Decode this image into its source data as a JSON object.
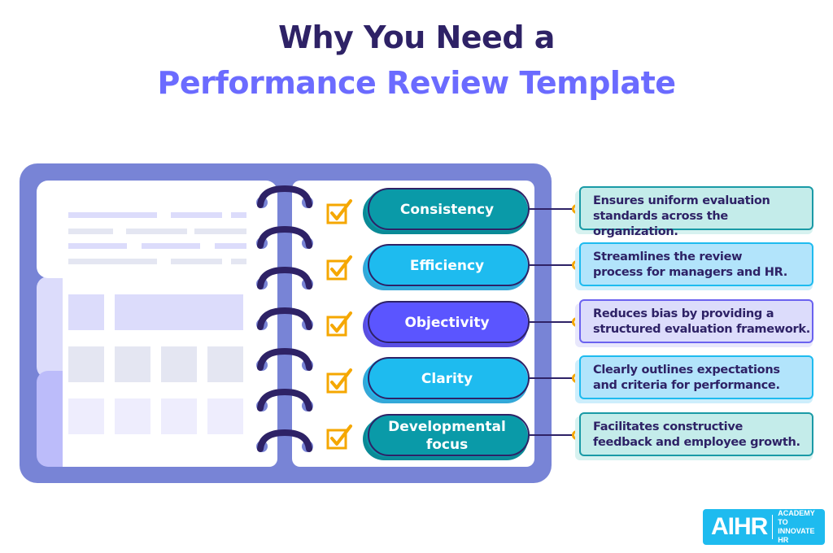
{
  "title": {
    "line1": "Why You Need a",
    "line2": "Performance Review Template"
  },
  "colors": {
    "title_dark": "#2e2266",
    "title_accent": "#6b6bff",
    "notebook": "#7884d6",
    "ring": "#2e2266",
    "check": "#f5a700"
  },
  "benefits": [
    {
      "label": "Consistency",
      "description_line1": "Ensures uniform evaluation",
      "description_line2": "standards across the organization.",
      "pill_color": "#0a9aa8",
      "pill_shadow": "#0a8a96",
      "box_bg": "#c4ecea",
      "box_border": "#1a9aa6",
      "box_shadow": "#d7f2f0"
    },
    {
      "label": "Efficiency",
      "description_line1": "Streamlines the review",
      "description_line2": "process for managers and HR.",
      "pill_color": "#1ebbef",
      "pill_shadow": "#34a8d8",
      "box_bg": "#b2e4fb",
      "box_border": "#1ebbef",
      "box_shadow": "#cdeefc"
    },
    {
      "label": "Objectivity",
      "description_line1": "Reduces bias by providing a",
      "description_line2": "structured evaluation framework.",
      "pill_color": "#5b55ff",
      "pill_shadow": "#5a4fe0",
      "box_bg": "#dcdcfb",
      "box_border": "#6b62ef",
      "box_shadow": "#e8e7fc"
    },
    {
      "label": "Clarity",
      "description_line1": "Clearly outlines expectations",
      "description_line2": "and criteria for performance.",
      "pill_color": "#1ebbef",
      "pill_shadow": "#34a8d8",
      "box_bg": "#b2e4fb",
      "box_border": "#1ebbef",
      "box_shadow": "#cdeefc"
    },
    {
      "label": "Developmental focus",
      "label_line1": "Developmental",
      "label_line2": "focus",
      "description_line1": "Facilitates constructive",
      "description_line2": "feedback and employee growth.",
      "pill_color": "#0a9aa8",
      "pill_shadow": "#0a8a96",
      "box_bg": "#c4ecea",
      "box_border": "#1a9aa6",
      "box_shadow": "#d7f2f0"
    }
  ],
  "logo": {
    "mark": "AIHR",
    "tagline_line1": "ACADEMY TO",
    "tagline_line2": "INNOVATE HR"
  }
}
